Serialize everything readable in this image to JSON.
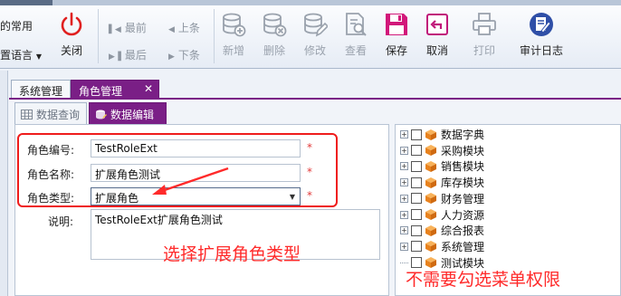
{
  "ribbon": {
    "left_top_label": "的常用",
    "left_bottom_label": "置语言",
    "close_label": "关闭",
    "nav": {
      "first": "最前",
      "prev": "上条",
      "last": "最后",
      "next": "下条"
    },
    "buttons": {
      "add": "新增",
      "delete": "删除",
      "edit": "修改",
      "view": "查看",
      "save": "保存",
      "cancel": "取消",
      "print": "打印",
      "audit_log": "审计日志"
    }
  },
  "doc_tabs": {
    "inactive": "系统管理",
    "active": "角色管理"
  },
  "sub_tabs": {
    "query": "数据查询",
    "edit": "数据编辑"
  },
  "form": {
    "code_label": "角色编号:",
    "code_value": "TestRoleExt",
    "name_label": "角色名称:",
    "name_value": "扩展角色测试",
    "type_label": "角色类型:",
    "type_value": "扩展角色",
    "desc_label": "说明:",
    "desc_value": "TestRoleExt扩展角色测试",
    "required_mark": "*"
  },
  "annotations": {
    "select_type": "选择扩展角色类型",
    "no_menu_perm": "不需要勾选菜单权限"
  },
  "tree": {
    "items": [
      {
        "label": "数据字典",
        "expandable": true
      },
      {
        "label": "采购模块",
        "expandable": true
      },
      {
        "label": "销售模块",
        "expandable": true
      },
      {
        "label": "库存模块",
        "expandable": true
      },
      {
        "label": "财务管理",
        "expandable": true
      },
      {
        "label": "人力资源",
        "expandable": true
      },
      {
        "label": "综合报表",
        "expandable": true
      },
      {
        "label": "系统管理",
        "expandable": true
      },
      {
        "label": "测试模块",
        "expandable": false
      }
    ]
  },
  "colors": {
    "accent": "#7a1f86",
    "annotation_red": "#ff2a2a",
    "required": "#e23a3a"
  }
}
